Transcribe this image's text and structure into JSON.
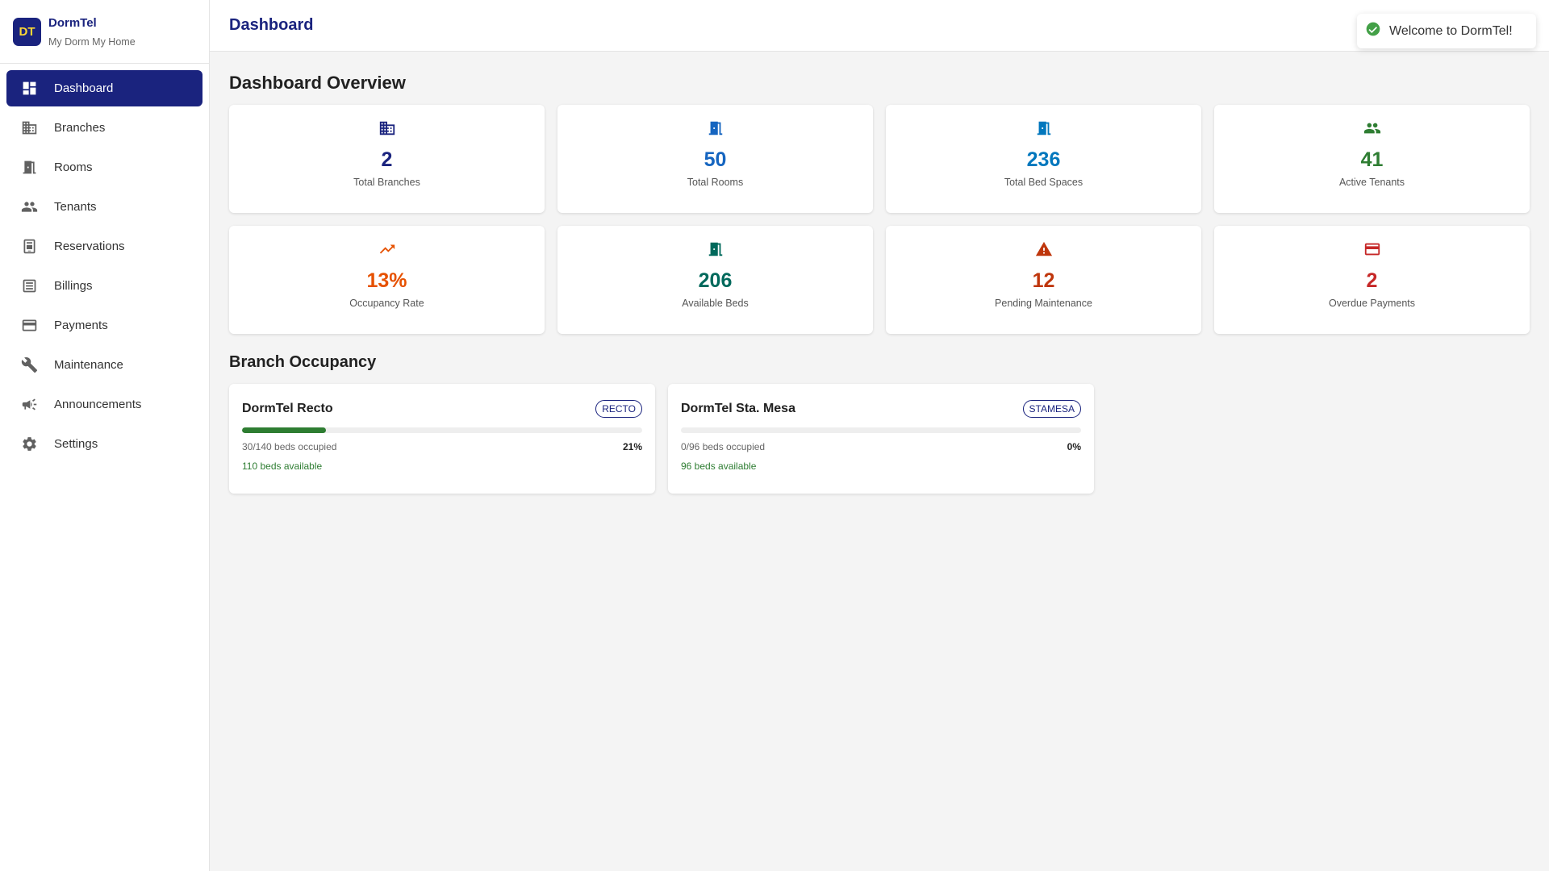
{
  "brand": {
    "logo": "DT",
    "name": "DormTel",
    "tagline": "My Dorm My Home"
  },
  "sidebar": {
    "items": [
      {
        "label": "Dashboard",
        "icon": "dashboard-icon",
        "active": true
      },
      {
        "label": "Branches",
        "icon": "building-icon"
      },
      {
        "label": "Rooms",
        "icon": "door-icon"
      },
      {
        "label": "Tenants",
        "icon": "people-icon"
      },
      {
        "label": "Reservations",
        "icon": "reservation-icon"
      },
      {
        "label": "Billings",
        "icon": "receipt-icon"
      },
      {
        "label": "Payments",
        "icon": "credit-card-icon"
      },
      {
        "label": "Maintenance",
        "icon": "wrench-icon"
      },
      {
        "label": "Announcements",
        "icon": "megaphone-icon"
      },
      {
        "label": "Settings",
        "icon": "gear-icon"
      }
    ]
  },
  "header": {
    "title": "Dashboard"
  },
  "overview": {
    "title": "Dashboard Overview",
    "stats": [
      {
        "value": "2",
        "label": "Total Branches",
        "icon": "building-icon",
        "color": "#1a237e"
      },
      {
        "value": "50",
        "label": "Total Rooms",
        "icon": "door-icon",
        "color": "#1565c0"
      },
      {
        "value": "236",
        "label": "Total Bed Spaces",
        "icon": "door-icon",
        "color": "#0277bd"
      },
      {
        "value": "41",
        "label": "Active Tenants",
        "icon": "people-icon",
        "color": "#2e7d32"
      },
      {
        "value": "13%",
        "label": "Occupancy Rate",
        "icon": "trending-up-icon",
        "color": "#e65100"
      },
      {
        "value": "206",
        "label": "Available Beds",
        "icon": "door-icon",
        "color": "#00695c"
      },
      {
        "value": "12",
        "label": "Pending Maintenance",
        "icon": "warning-icon",
        "color": "#bf360c"
      },
      {
        "value": "2",
        "label": "Overdue Payments",
        "icon": "credit-card-icon",
        "color": "#c62828"
      }
    ]
  },
  "branch_occupancy": {
    "title": "Branch Occupancy",
    "branches": [
      {
        "name": "DormTel Recto",
        "code": "RECTO",
        "occupied_text": "30/140 beds occupied",
        "percent_text": "21%",
        "fill_percent": 21,
        "available_text": "110 beds available"
      },
      {
        "name": "DormTel Sta. Mesa",
        "code": "STAMESA",
        "occupied_text": "0/96 beds occupied",
        "percent_text": "0%",
        "fill_percent": 0,
        "available_text": "96 beds available"
      }
    ]
  },
  "toast": {
    "message": "Welcome to DormTel!",
    "icon": "check-circle-icon",
    "color": "#43a047"
  }
}
